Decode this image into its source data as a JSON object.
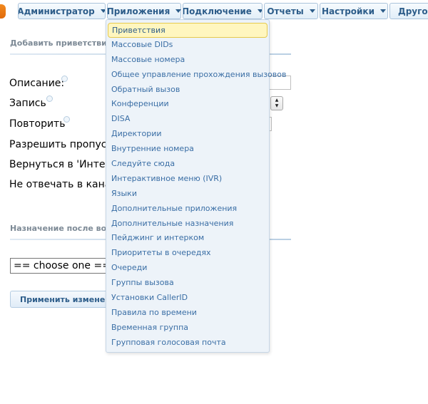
{
  "nav": {
    "items": [
      {
        "label": "Администратор"
      },
      {
        "label": "Приложения"
      },
      {
        "label": "Подключение"
      },
      {
        "label": "Отчеты"
      },
      {
        "label": "Настройки"
      },
      {
        "label": "Другое"
      }
    ]
  },
  "form": {
    "section1_title": "Добавить приветствие",
    "labels": [
      "Описание:",
      "Запись",
      "Повторить",
      "Разрешить пропусти",
      "Вернуться в 'Интера",
      "Не отвечать в канал"
    ],
    "section2_title": "Назначение после восп",
    "destination_select": "== choose one ==",
    "apply_button": "Применить изменени"
  },
  "dropdown": {
    "items": [
      {
        "label": "Приветствия",
        "highlighted": true
      },
      {
        "label": "Массовые DIDs"
      },
      {
        "label": "Массовые номера"
      },
      {
        "label": "Общее управление прохождения вызовов"
      },
      {
        "label": "Обратный вызов"
      },
      {
        "label": "Конференции"
      },
      {
        "label": "DISA"
      },
      {
        "label": "Директории"
      },
      {
        "label": "Внутренние номера"
      },
      {
        "label": "Следуйте сюда"
      },
      {
        "label": "Интерактивное меню (IVR)"
      },
      {
        "label": "Языки"
      },
      {
        "label": "Дополнительные приложения"
      },
      {
        "label": "Дополнительные назначения"
      },
      {
        "label": "Пейджинг и интерком"
      },
      {
        "label": "Приоритеты в очередях"
      },
      {
        "label": "Очереди"
      },
      {
        "label": "Группы вызова"
      },
      {
        "label": "Установки CallerID"
      },
      {
        "label": "Правила по времени"
      },
      {
        "label": "Временная группа"
      },
      {
        "label": "Групповая голосовая почта"
      }
    ]
  },
  "colors": {
    "accent": "#2d5d8a",
    "link": "#3a6ea5",
    "active_underline": "#d9141a",
    "highlight_bg": "#fff6bf"
  }
}
